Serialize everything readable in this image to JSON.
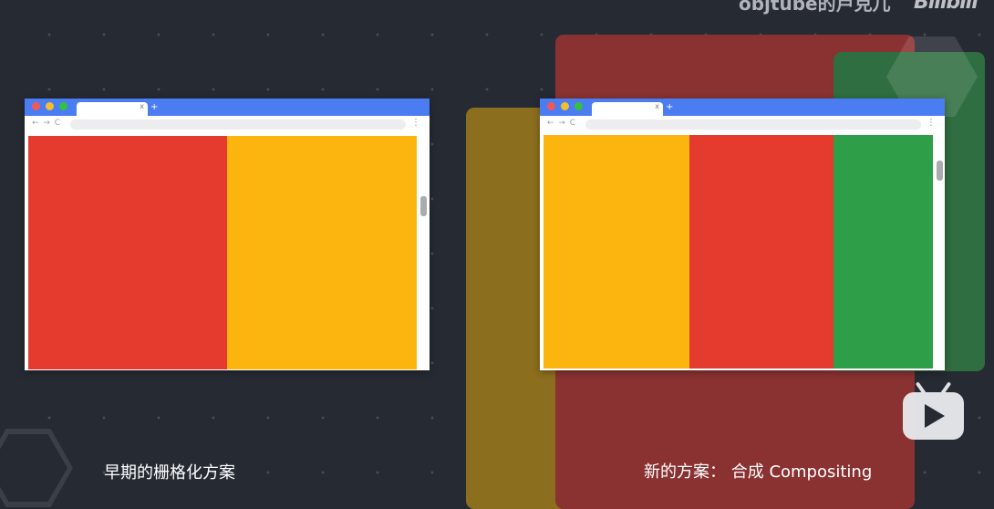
{
  "watermark": {
    "text": "objtube的卢克儿",
    "logo_text": "Bilibili"
  },
  "browser_left": {
    "tab_close_glyph": "x",
    "new_tab_glyph": "+",
    "nav_glyphs": "← → C",
    "menu_glyph": "⋮",
    "blocks": [
      {
        "color": "#e53b2f",
        "name": "red"
      },
      {
        "color": "#fcb40f",
        "name": "yellow"
      }
    ]
  },
  "browser_right": {
    "tab_close_glyph": "x",
    "new_tab_glyph": "+",
    "nav_glyphs": "← → C",
    "menu_glyph": "⋮",
    "blocks": [
      {
        "color": "#fcb40f",
        "name": "yellow"
      },
      {
        "color": "#e53b2f",
        "name": "red"
      },
      {
        "color": "#2f9e49",
        "name": "green"
      }
    ]
  },
  "layers": {
    "yellow": "#8c6f1e",
    "red": "#8a3232",
    "green": "#2f6e40"
  },
  "captions": {
    "left": "早期的栅格化方案",
    "right": "新的方案： 合成 Compositing"
  },
  "colors": {
    "background": "#262a33",
    "titlebar": "#4a7cf2"
  }
}
